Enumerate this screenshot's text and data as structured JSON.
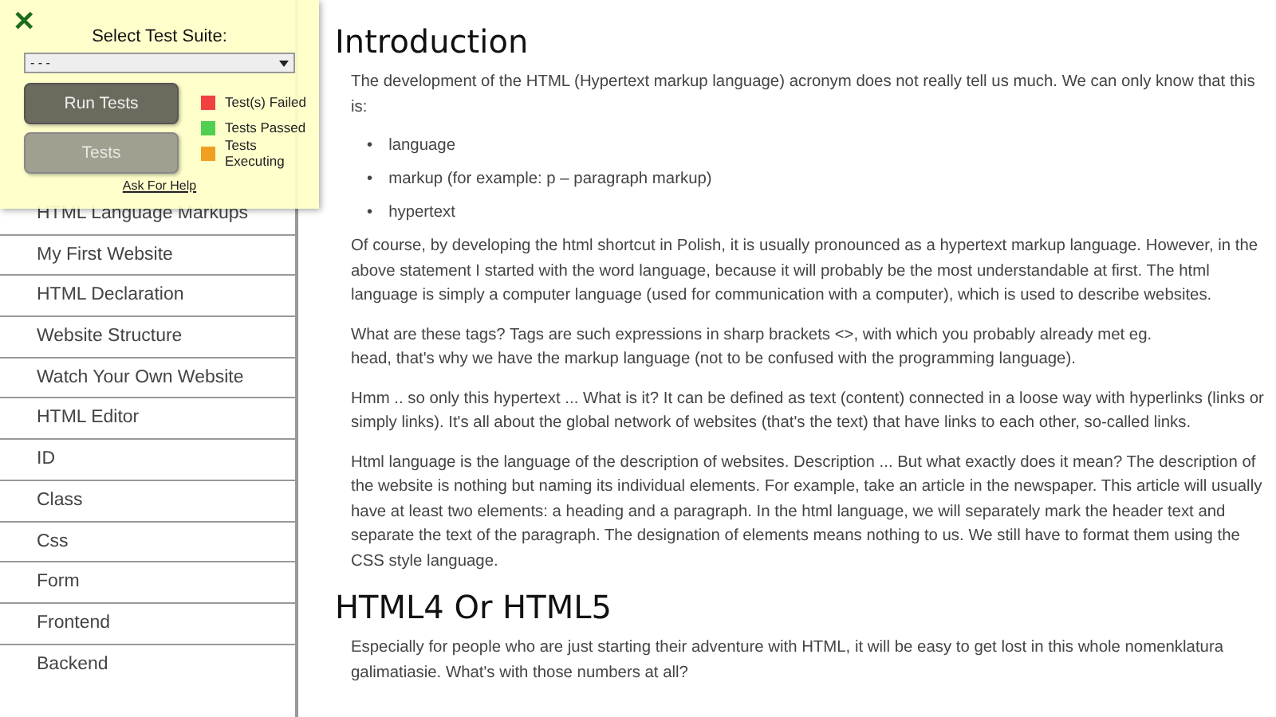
{
  "sidebar": {
    "items": [
      {
        "label": "HTML Language Markups"
      },
      {
        "label": "My First Website"
      },
      {
        "label": "HTML Declaration"
      },
      {
        "label": "Website Structure"
      },
      {
        "label": "Watch Your Own Website"
      },
      {
        "label": "HTML Editor"
      },
      {
        "label": "ID"
      },
      {
        "label": "Class"
      },
      {
        "label": "Css"
      },
      {
        "label": "Form"
      },
      {
        "label": "Frontend"
      },
      {
        "label": "Backend"
      }
    ]
  },
  "test_panel": {
    "close": "✕",
    "title": "Select Test Suite:",
    "suite_select": {
      "value": "- - -"
    },
    "buttons": [
      {
        "label": "Run Tests",
        "disabled": false
      },
      {
        "label": "Tests",
        "disabled": true
      }
    ],
    "legend": [
      {
        "label": "Test(s) Failed",
        "color": "#f04040"
      },
      {
        "label": "Tests Passed",
        "color": "#50d050"
      },
      {
        "label": "Tests Executing",
        "color": "#f0a020"
      }
    ],
    "help_link": "Ask For Help"
  },
  "content": [
    {
      "kind": "heading",
      "text": "Introduction"
    },
    {
      "kind": "paragraph",
      "text": "The development of the HTML (Hypertext markup language) acronym does not really tell us much. We can only know that this is:"
    },
    {
      "kind": "list",
      "items": [
        {
          "bullet": "•",
          "text": "language"
        },
        {
          "bullet": "•",
          "text": "markup (for example: p – paragraph markup)"
        },
        {
          "bullet": "•",
          "text": "hypertext"
        }
      ]
    },
    {
      "kind": "paragraph",
      "text": "Of course, by developing the html shortcut in Polish, it is usually pronounced as a hypertext markup language. However, in the above statement I started with the word language, because it will probably be the most understandable at first. The html language is simply a computer language (used for communication with a computer), which is used to describe websites."
    },
    {
      "kind": "paragraph",
      "text": "What are these tags? Tags are such expressions in sharp brackets <>, with which you probably already met eg.\nhead, that's why we have the markup language (not to be confused with the programming language)."
    },
    {
      "kind": "paragraph",
      "text": "Hmm .. so only this hypertext ... What is it? It can be defined as text (content) connected in a loose way with hyperlinks (links or simply links). It's all about the global network of websites (that's the text) that have links to each other, so-called links."
    },
    {
      "kind": "paragraph",
      "text": "Html language is the language of the description of websites. Description ... But what exactly does it mean? The description of the website is nothing but naming its individual elements. For example, take an article in the newspaper. This article will usually have at least two elements: a heading and a paragraph. In the html language, we will separately mark the header text and separate the text of the paragraph. The designation of elements means nothing to us. We still have to format them using the CSS style language."
    },
    {
      "kind": "heading",
      "text": "HTML4 Or HTML5"
    },
    {
      "kind": "paragraph",
      "text": "Especially for people who are just starting their adventure with HTML, it will be easy to get lost in this whole nomenklatura galimatiasie. What's with those numbers at all?"
    }
  ]
}
